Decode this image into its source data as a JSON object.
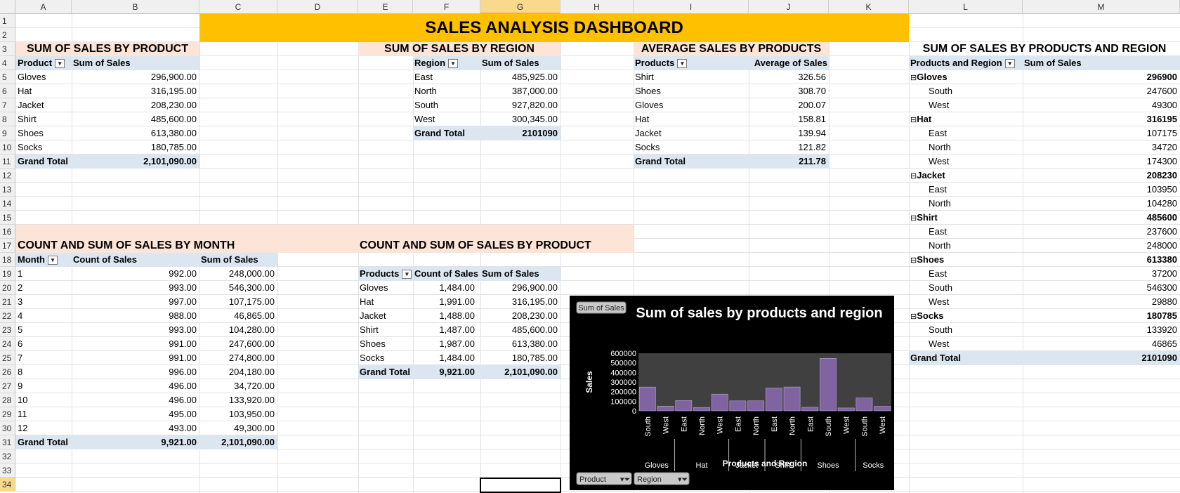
{
  "column_headers": [
    "A",
    "B",
    "C",
    "D",
    "E",
    "F",
    "G",
    "H",
    "I",
    "J",
    "K",
    "L",
    "M"
  ],
  "row_headers": [
    "1",
    "2",
    "3",
    "4",
    "5",
    "6",
    "7",
    "8",
    "9",
    "10",
    "11",
    "12",
    "13",
    "14",
    "15",
    "16",
    "17",
    "18",
    "19",
    "20",
    "21",
    "22",
    "23",
    "24",
    "25",
    "26",
    "27",
    "28",
    "29",
    "30",
    "31",
    "32",
    "33",
    "34"
  ],
  "title": "SALES ANALYSIS DASHBOARD",
  "product_sales": {
    "heading": "SUM OF SALES BY PRODUCT",
    "headers": [
      "Product",
      "Sum of Sales"
    ],
    "rows": [
      [
        "Gloves",
        "296,900.00"
      ],
      [
        "Hat",
        "316,195.00"
      ],
      [
        "Jacket",
        "208,230.00"
      ],
      [
        "Shirt",
        "485,600.00"
      ],
      [
        "Shoes",
        "613,380.00"
      ],
      [
        "Socks",
        "180,785.00"
      ]
    ],
    "total": [
      "Grand Total",
      "2,101,090.00"
    ]
  },
  "region_sales": {
    "heading": "SUM OF SALES BY REGION",
    "headers": [
      "Region",
      "Sum of Sales"
    ],
    "rows": [
      [
        "East",
        "485,925.00"
      ],
      [
        "North",
        "387,000.00"
      ],
      [
        "South",
        "927,820.00"
      ],
      [
        "West",
        "300,345.00"
      ]
    ],
    "total": [
      "Grand Total",
      "2101090"
    ]
  },
  "avg_sales": {
    "heading": "AVERAGE SALES BY PRODUCTS",
    "headers": [
      "Products",
      "Average of Sales"
    ],
    "rows": [
      [
        "Shirt",
        "326.56"
      ],
      [
        "Shoes",
        "308.70"
      ],
      [
        "Gloves",
        "200.07"
      ],
      [
        "Hat",
        "158.81"
      ],
      [
        "Jacket",
        "139.94"
      ],
      [
        "Socks",
        "121.82"
      ]
    ],
    "total": [
      "Grand Total",
      "211.78"
    ]
  },
  "prod_region": {
    "heading": "SUM OF SALES BY PRODUCTS AND REGION",
    "headers": [
      "Products and Region",
      "Sum of Sales"
    ],
    "rows": [
      {
        "label": "Gloves",
        "value": "296900",
        "group": true
      },
      {
        "label": "South",
        "value": "247600",
        "group": false
      },
      {
        "label": "West",
        "value": "49300",
        "group": false
      },
      {
        "label": "Hat",
        "value": "316195",
        "group": true
      },
      {
        "label": "East",
        "value": "107175",
        "group": false
      },
      {
        "label": "North",
        "value": "34720",
        "group": false
      },
      {
        "label": "West",
        "value": "174300",
        "group": false
      },
      {
        "label": "Jacket",
        "value": "208230",
        "group": true
      },
      {
        "label": "East",
        "value": "103950",
        "group": false
      },
      {
        "label": "North",
        "value": "104280",
        "group": false
      },
      {
        "label": "Shirt",
        "value": "485600",
        "group": true
      },
      {
        "label": "East",
        "value": "237600",
        "group": false
      },
      {
        "label": "North",
        "value": "248000",
        "group": false
      },
      {
        "label": "Shoes",
        "value": "613380",
        "group": true
      },
      {
        "label": "East",
        "value": "37200",
        "group": false
      },
      {
        "label": "South",
        "value": "546300",
        "group": false
      },
      {
        "label": "West",
        "value": "29880",
        "group": false
      },
      {
        "label": "Socks",
        "value": "180785",
        "group": true
      },
      {
        "label": "South",
        "value": "133920",
        "group": false
      },
      {
        "label": "West",
        "value": "46865",
        "group": false
      }
    ],
    "total": [
      "Grand Total",
      "2101090"
    ]
  },
  "month_sales": {
    "heading": "COUNT  AND SUM OF SALES BY MONTH",
    "headers": [
      "Month",
      "Count of Sales",
      "Sum of Sales"
    ],
    "rows": [
      [
        "1",
        "992.00",
        "248,000.00"
      ],
      [
        "2",
        "993.00",
        "546,300.00"
      ],
      [
        "3",
        "997.00",
        "107,175.00"
      ],
      [
        "4",
        "988.00",
        "46,865.00"
      ],
      [
        "5",
        "993.00",
        "104,280.00"
      ],
      [
        "6",
        "991.00",
        "247,600.00"
      ],
      [
        "7",
        "991.00",
        "274,800.00"
      ],
      [
        "8",
        "996.00",
        "204,180.00"
      ],
      [
        "9",
        "496.00",
        "34,720.00"
      ],
      [
        "10",
        "496.00",
        "133,920.00"
      ],
      [
        "11",
        "495.00",
        "103,950.00"
      ],
      [
        "12",
        "493.00",
        "49,300.00"
      ]
    ],
    "total": [
      "Grand Total",
      "9,921.00",
      "2,101,090.00"
    ]
  },
  "count_products": {
    "heading": "COUNT AND SUM OF SALES BY PRODUCTS",
    "headers": [
      "Products",
      "Count of Sales",
      "Sum of Sales"
    ],
    "rows": [
      [
        "Gloves",
        "1,484.00",
        "296,900.00"
      ],
      [
        "Hat",
        "1,991.00",
        "316,195.00"
      ],
      [
        "Jacket",
        "1,488.00",
        "208,230.00"
      ],
      [
        "Shirt",
        "1,487.00",
        "485,600.00"
      ],
      [
        "Shoes",
        "1,987.00",
        "613,380.00"
      ],
      [
        "Socks",
        "1,484.00",
        "180,785.00"
      ]
    ],
    "total": [
      "Grand Total",
      "9,921.00",
      "2,101,090.00"
    ]
  },
  "colors": {
    "title_band": "#ffc000",
    "section_band": "#fce4d6",
    "pivot_header": "#dce6f1",
    "chart_bg": "#000000",
    "plot_bg": "#404040",
    "bar": "#8064a2"
  },
  "chart_data": {
    "type": "bar",
    "title": "Sum of sales by products and region",
    "xlabel": "Products and Region",
    "ylabel": "Sales",
    "field_button": "Sum of Sales",
    "filters": [
      "Product",
      "Region"
    ],
    "ylim": [
      0,
      600000
    ],
    "yticks": [
      "600000",
      "500000",
      "400000",
      "300000",
      "200000",
      "100000",
      "0"
    ],
    "groups": [
      {
        "name": "Gloves",
        "categories": [
          "South",
          "West"
        ],
        "values": [
          247600,
          49300
        ]
      },
      {
        "name": "Hat",
        "categories": [
          "East",
          "North",
          "West"
        ],
        "values": [
          107175,
          34720,
          174300
        ]
      },
      {
        "name": "Jacket",
        "categories": [
          "East",
          "North"
        ],
        "values": [
          103950,
          104280
        ]
      },
      {
        "name": "Shirt",
        "categories": [
          "East",
          "North"
        ],
        "values": [
          237600,
          248000
        ]
      },
      {
        "name": "Shoes",
        "categories": [
          "East",
          "South",
          "West"
        ],
        "values": [
          37200,
          546300,
          29880
        ]
      },
      {
        "name": "Socks",
        "categories": [
          "South",
          "West"
        ],
        "values": [
          133920,
          46865
        ]
      }
    ],
    "grid": false,
    "legend": "none"
  }
}
